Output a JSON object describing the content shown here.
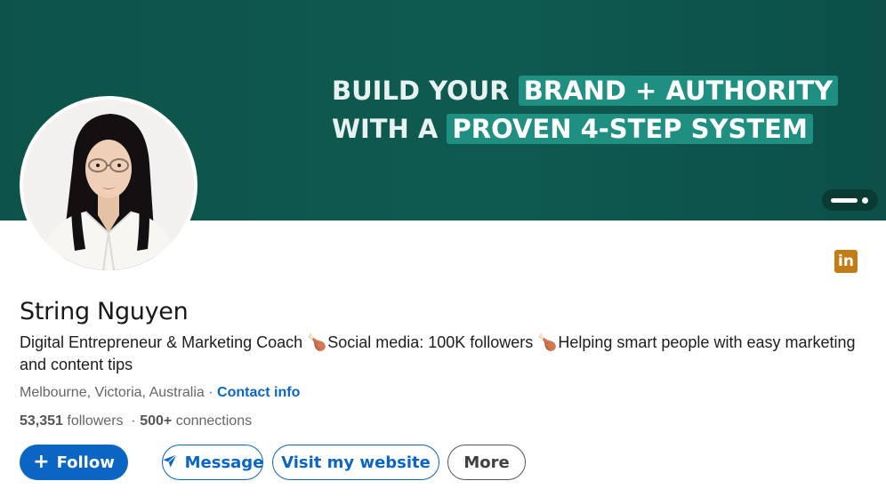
{
  "banner": {
    "line1_plain": "BUILD YOUR",
    "line1_highlight": "BRAND + AUTHORITY",
    "line2_plain": "WITH A",
    "line2_highlight": "PROVEN 4-STEP SYSTEM",
    "colors": {
      "background": "#0e5a51",
      "highlight": "#1f8f82"
    }
  },
  "profile": {
    "name": "String Nguyen",
    "headline_part1": "Digital Entrepreneur & Marketing Coach",
    "headline_emoji1": "🍗",
    "headline_part2": "Social media: 100K followers",
    "headline_emoji2": "🍗",
    "headline_part3": "Helping smart people with easy marketing and content tips",
    "location": "Melbourne, Victoria, Australia",
    "separator": "·",
    "contact_info": "Contact info",
    "followers_count": "53,351",
    "followers_label": "followers",
    "connections_count": "500+",
    "connections_label": "connections",
    "badge_icon": "linkedin-icon",
    "badge_text": "in"
  },
  "actions": {
    "follow_icon": "+",
    "follow": "Follow",
    "message_icon": "paper-plane-icon",
    "message": "Message",
    "website": "Visit my website",
    "more": "More"
  },
  "colors": {
    "accent": "#0a66c2",
    "linkedin_badge": "#c37d16"
  }
}
